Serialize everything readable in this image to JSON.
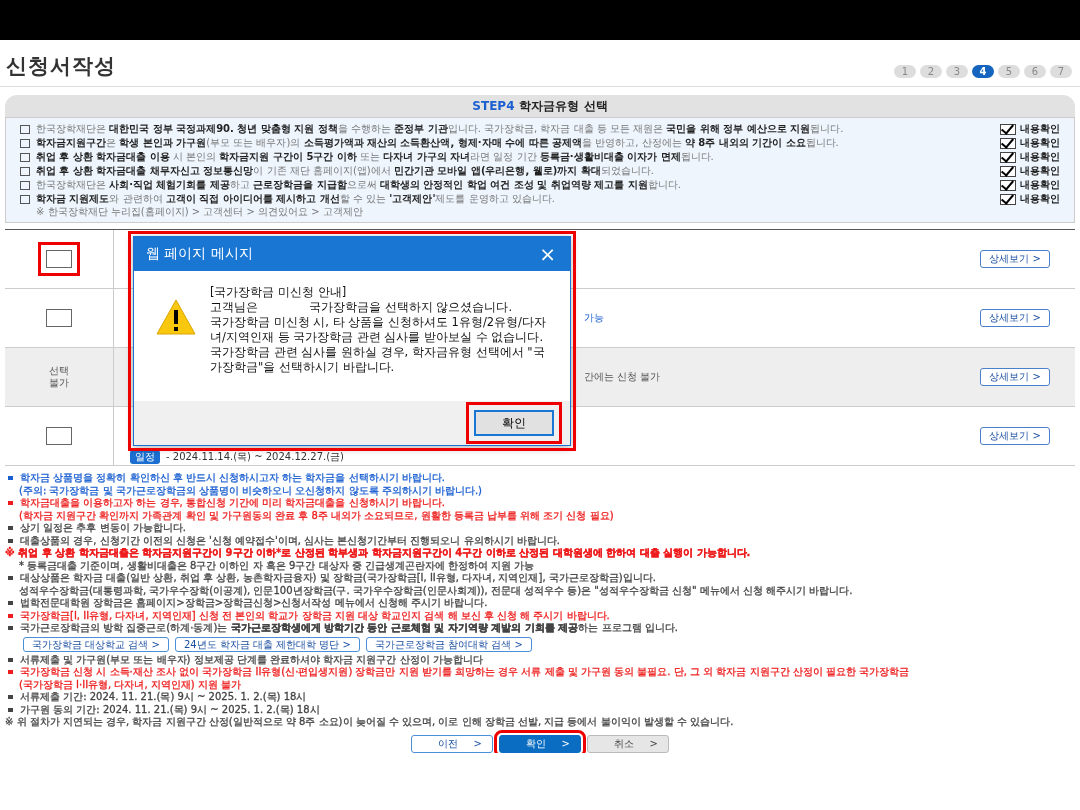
{
  "page": {
    "title": "신청서작성"
  },
  "steps": [
    {
      "label": "1",
      "selected": false
    },
    {
      "label": "2",
      "selected": false
    },
    {
      "label": "3",
      "selected": false
    },
    {
      "label": "4",
      "selected": true
    },
    {
      "label": "5",
      "selected": false
    },
    {
      "label": "6",
      "selected": false
    },
    {
      "label": "7",
      "selected": false
    }
  ],
  "section": {
    "step": "STEP4",
    "title": "학자금유형 선택"
  },
  "notice": {
    "items": [
      {
        "text": "한국장학재단은 **대한민국 정부 국정과제90. 청년 맞춤형 지원 정책**을 수행하는 **준정부 기관**입니다. 국가장학금, 학자금 대출 등 모든 재원은 **국민을 위해 정부 예산으로 지원**됩니다.",
        "confirm_label": "내용확인",
        "confirmed": true
      },
      {
        "text": "**학자금지원구간**은 **학생 본인과 가구원**(부모 또는 배우자)의 **소득평가액과 재산의 소득환산액, 형제·자매 수에 따른 공제액**을 반영하고, 산정에는 **약 8주 내외의 기간이 소요**됩니다.",
        "confirm_label": "내용확인",
        "confirmed": true
      },
      {
        "text": "**취업 후 상환 학자금대출 이용** 시 본인의 **학자금지원 구간이 5구간 이하** 또는 **다자녀 가구의 자녀**라면 일정 기간 **등록금·생활비대출 이자가 면제**됩니다.",
        "confirm_label": "내용확인",
        "confirmed": true
      },
      {
        "text": "**취업 후 상환 학자금대출 채무자신고 정보통신망**이 기존 재단 홈페이지(앱)에서 **민간기관 모바일 앱(우리은행, 웰로)까지 확대**되었습니다.",
        "confirm_label": "내용확인",
        "confirmed": true
      },
      {
        "text": "한국장학재단은 **사회·직업 체험기회를 제공**하고 **근로장학금을 지급함**으로써 **대학생의 안정적인 학업 여건 조성 및 취업역량 제고를 지원**합니다.",
        "confirm_label": "내용확인",
        "confirmed": true
      },
      {
        "text": "**학자금 지원제도**와 관련하여 **고객이 직접 아이디어를 제시하고 개선**할 수 있는 **'고객제안'**제도를 운영하고 있습니다.",
        "note": "※ 한국장학재단 누리집(홈페이지) > 고객센터 > 의견있어요 > 고객제안",
        "confirm_label": "내용확인",
        "confirmed": true
      }
    ]
  },
  "rows": [
    {
      "kind": "checkbox",
      "checked": false,
      "highlighted": true,
      "detail": "상세보기 >"
    },
    {
      "kind": "checkbox",
      "checked": false,
      "fragment": "가능",
      "detail": "상세보기 >"
    },
    {
      "kind": "unavailable",
      "status": "선택 불가",
      "fragment": "간에는 신청 불가",
      "detail": "상세보기 >"
    },
    {
      "kind": "checkbox",
      "checked": false,
      "schedule": {
        "tag": "일정",
        "text": "- 2024.11.14.(목) ~ 2024.12.27.(금)"
      },
      "detail": "상세보기 >"
    }
  ],
  "dialog": {
    "title": "웹 페이지 메시지",
    "close": "×",
    "lines": [
      "[국가장학금 미신청 안내]",
      "고객님은              국가장학금을 선택하지 않으셨습니다.",
      "국가장학금 미신청 시, 타 상품을 신청하셔도 1유형/2유형/다자",
      "녀/지역인재 등 국가장학금 관련 심사를 받아보실 수 없습니다.",
      "국가장학금 관련 심사를 원하실 경우, 학자금유형 선택에서 \"국",
      "가장학금\"을 선택하시기 바랍니다."
    ],
    "button": "확인",
    "highlighted": true,
    "button_highlighted": true
  },
  "notes": [
    {
      "kind": "bullet",
      "color": "#1a5fd0",
      "text": "학자금 상품명을 정확히 확인하신 후 반드시 신청하시고자 하는 학자금을 선택하시기 바랍니다."
    },
    {
      "kind": "continuation",
      "color": "#1a5fd0",
      "text": "(주의: 국가장학금 및 국가근로장학금의 상품명이 비슷하오니 오신청하지 않도록 주의하시기 바랍니다.)"
    },
    {
      "kind": "bullet",
      "color": "#ee1c1c",
      "text": "학자금대출을 이용하고자 하는 경우, 통합신청 기간에 미리 학자금대출을 신청하시기 바랍니다."
    },
    {
      "kind": "continuation",
      "color": "#ee1c1c",
      "text": "(학자금 지원구간 확인까지 가족관계 확인 및 가구원동의 완료 후 8주 내외가 소요되므로, 원활한 등록금 납부를 위해 조기 신청 필요)"
    },
    {
      "kind": "bullet",
      "color": "#444444",
      "text": "상기 일정은 추후 변동이 가능합니다."
    },
    {
      "kind": "bullet",
      "color": "#444444",
      "text": "대출상품의 경우, 신청기간 이전의 신청은 '신청 예약접수'이며, 심사는 본신청기간부터 진행되오니 유의하시기 바랍니다."
    },
    {
      "kind": "reference",
      "color": "#ee1c1c",
      "bold": true,
      "text": "※ 취업 후 상환 학자금대출은 학자금지원구간이 9구간 이하*로 산정된 학부생과 학자금지원구간이 4구간 이하로 산정된 대학원생에 한하여 대출 실행이 가능합니다."
    },
    {
      "kind": "continuation",
      "color": "#444444",
      "text": "* 등록금대출 기준이며, 생활비대출은 8구간 이하인 자 혹은 9구간 대상자 중 긴급생계곤란자에 한정하여 지원 가능"
    },
    {
      "kind": "bullet",
      "color": "#444444",
      "text": "대상상품은 학자금 대출(일반 상환, 취업 후 상환, 농촌학자금융자) 및 장학금(국가장학금[I, II유형, 다자녀, 지역인재], 국가근로장학금)입니다."
    },
    {
      "kind": "continuation",
      "color": "#444444",
      "text": "성적우수장학금(대통령과학, 국가우수장학(이공계), 인문100년장학금(구. 국가우수장학금(인문사회계)), 전문대 성적우수 등)은 \"성적우수장학금 신청\" 메뉴에서 신청 해주시기 바랍니다."
    },
    {
      "kind": "bullet",
      "color": "#444444",
      "text": "법학전문대학원 장학금은 홈페이지>장학금>장학금신청>신청서작성 메뉴에서 신청해 주시기 바랍니다."
    },
    {
      "kind": "bullet",
      "color": "#ee1c1c",
      "text": "국가장학금[I, II유형, 다자녀, 지역인재] 신청 전 본인의 학교가 장학금 지원 대상 학교인지 검색 해 보신 후 신청 해 주시기 바랍니다."
    },
    {
      "kind": "bullet",
      "color": "#444444",
      "text": "국가근로장학금의 방학 집중근로(하계·동계)는 **국가근로장학생에게 방학기간 동안 근로체험 및 자기역량 계발의 기회를 제공**하는 프로그램 입니다."
    },
    {
      "kind": "links",
      "links": [
        "국가장학금 대상학교 검색 >",
        "24년도 학자금 대출 제한대학 명단 >",
        "국가근로장학금 참여대학 검색 >"
      ]
    },
    {
      "kind": "bullet",
      "color": "#444444",
      "text": "서류제출 및 가구원(부모 또는 배우자) 정보제공 단계를 완료하셔야 학자금 지원구간 산정이 가능합니다"
    },
    {
      "kind": "bullet",
      "color": "#ee1c1c",
      "text": "국가장학금 신청 시 소득·재산 조사 없이 국가장학금 II유형(신·편입생지원) 장학금만 지원 받기를 희망하는 경우 서류 제출 및 가구원 동의 불필요. 단, 그 외 학자금 지원구간 산정이 필요한 국가장학금"
    },
    {
      "kind": "continuation",
      "color": "#ee1c1c",
      "text": "(국가장학금 I·II유형, 다자녀, 지역인재) 지원 불가"
    },
    {
      "kind": "bullet",
      "color": "#444444",
      "text": "서류제출 기간: 2024. 11. 21.(목) 9시 ~ 2025. 1. 2.(목) 18시"
    },
    {
      "kind": "bullet",
      "color": "#444444",
      "text": "가구원 동의 기간: 2024. 11. 21.(목) 9시 ~ 2025. 1. 2.(목) 18시"
    },
    {
      "kind": "reference",
      "color": "#444444",
      "text": "※ 위 절차가 지연되는 경우, 학자금 지원구간 산정(일반적으로 약 8주 소요)이 늦어질 수 있으며, 이로 인해 장학금 선발, 지급 등에서 불이익이 발생할 수 있습니다."
    }
  ],
  "actions": [
    {
      "kind": "secondary",
      "label": "이전",
      "arrow": ">"
    },
    {
      "kind": "primary",
      "label": "확인",
      "arrow": ">",
      "highlighted": true
    },
    {
      "kind": "cancel",
      "label": "취소",
      "arrow": ">"
    }
  ]
}
